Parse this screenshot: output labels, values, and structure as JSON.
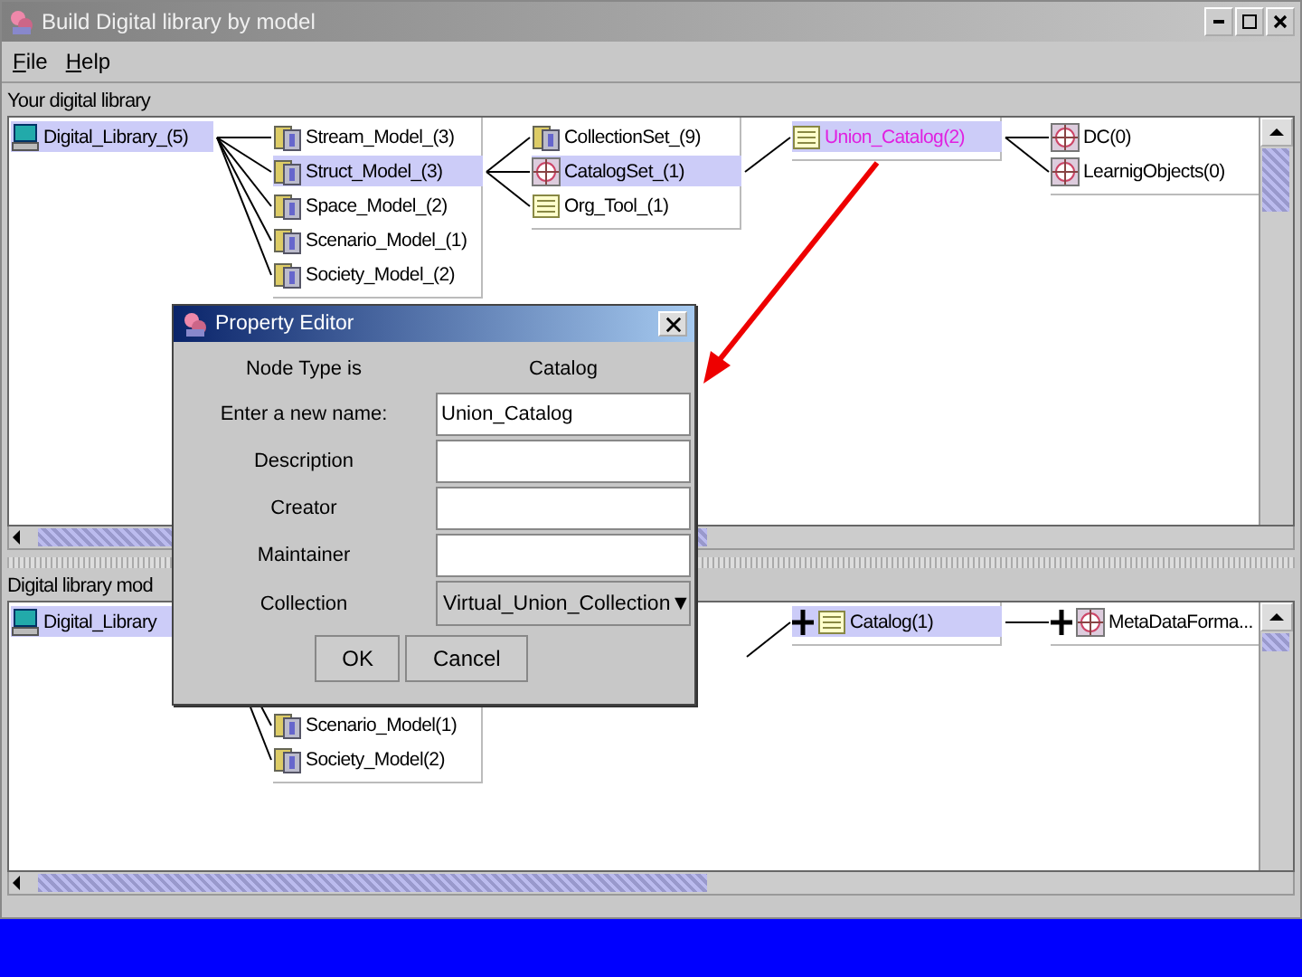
{
  "window": {
    "title": "Build Digital library by model"
  },
  "menu": [
    {
      "label": "File"
    },
    {
      "label": "Help"
    }
  ],
  "top_pane": {
    "label": "Your digital library",
    "tree": {
      "label": "Digital_Library_(5)",
      "kind": "computer",
      "selected": true,
      "children": [
        {
          "label": "Stream_Model_(3)",
          "kind": "model",
          "selected": false
        },
        {
          "label": "Struct_Model_(3)",
          "kind": "model",
          "selected": true,
          "children": [
            {
              "label": "CollectionSet_(9)",
              "kind": "model",
              "selected": false
            },
            {
              "label": "CatalogSet_(1)",
              "kind": "target",
              "selected": true,
              "children": [
                {
                  "label": "Union_Catalog(2)",
                  "kind": "notepad",
                  "selected": true,
                  "editing": true,
                  "children": [
                    {
                      "label": "DC(0)",
                      "kind": "target",
                      "selected": false
                    },
                    {
                      "label": "LearnigObjects(0)",
                      "kind": "target",
                      "selected": false
                    }
                  ]
                }
              ]
            },
            {
              "label": "Org_Tool_(1)",
              "kind": "notepad",
              "selected": false
            }
          ]
        },
        {
          "label": "Space_Model_(2)",
          "kind": "model",
          "selected": false
        },
        {
          "label": "Scenario_Model_(1)",
          "kind": "model",
          "selected": false
        },
        {
          "label": "Society_Model_(2)",
          "kind": "model",
          "selected": false
        }
      ]
    }
  },
  "bottom_pane": {
    "label": "Digital library mod",
    "trees": [
      {
        "label": "Digital_Library",
        "kind": "computer",
        "selected": true,
        "children": [
          {
            "label": "Scenario_Model(1)",
            "kind": "model",
            "selected": false
          },
          {
            "label": "Society_Model(2)",
            "kind": "model",
            "selected": false
          }
        ]
      },
      {
        "label": "Catalog(1)",
        "kind": "notepad",
        "selected": true,
        "expandable": true,
        "children": [
          {
            "label": "MetaDataForma...",
            "kind": "target",
            "selected": false,
            "expandable": true
          }
        ]
      }
    ]
  },
  "dialog": {
    "title": "Property Editor",
    "rows": [
      {
        "kind": "info",
        "label": "Node Type is",
        "value": "Catalog"
      },
      {
        "kind": "text",
        "label": "Enter a new name:",
        "value": "Union_Catalog"
      },
      {
        "kind": "text",
        "label": "Description"
      },
      {
        "kind": "text",
        "label": "Creator"
      },
      {
        "kind": "text",
        "label": "Maintainer"
      },
      {
        "kind": "combo",
        "label": "Collection",
        "value": "Virtual_Union_Collection",
        "arrow": "▼"
      }
    ],
    "buttons": [
      "OK",
      "Cancel"
    ]
  }
}
